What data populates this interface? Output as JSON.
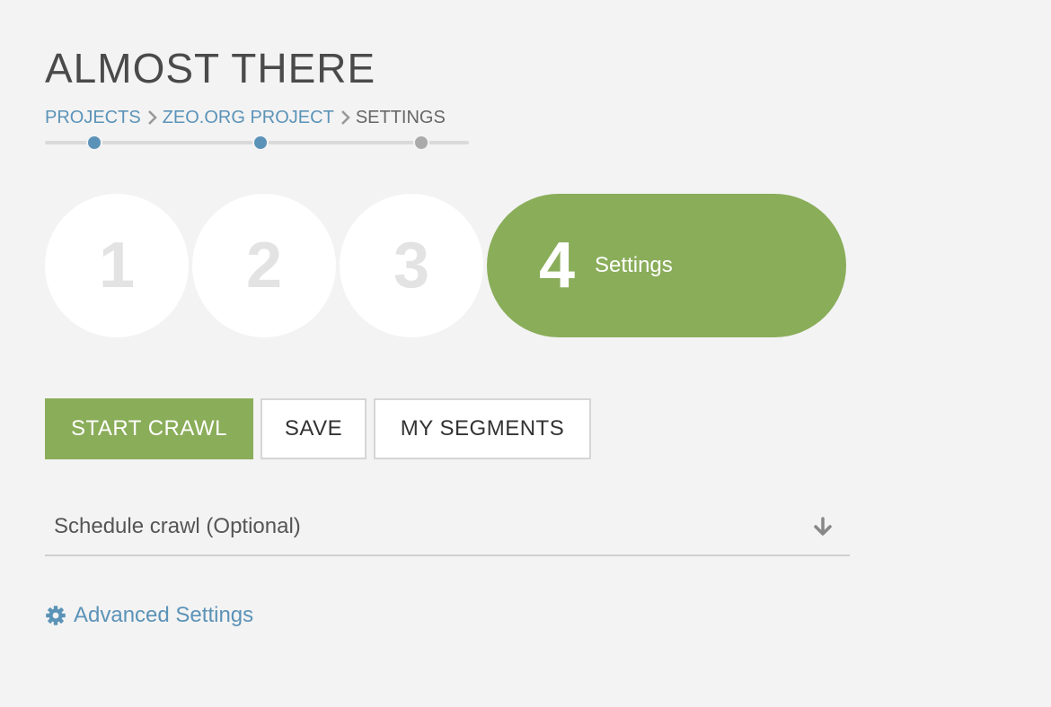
{
  "page": {
    "title": "ALMOST THERE"
  },
  "breadcrumb": {
    "items": [
      {
        "label": "PROJECTS",
        "link": true
      },
      {
        "label": "ZEO.ORG PROJECT",
        "link": true
      },
      {
        "label": "SETTINGS",
        "link": false
      }
    ],
    "separator_icon": "chevron-right-icon"
  },
  "progress": {
    "dots": [
      {
        "state": "complete",
        "color": "#5b93b8"
      },
      {
        "state": "complete",
        "color": "#5b93b8"
      },
      {
        "state": "current",
        "color": "#aaaaaa"
      }
    ]
  },
  "steps": {
    "items": [
      {
        "number": "1"
      },
      {
        "number": "2"
      },
      {
        "number": "3"
      }
    ],
    "active": {
      "number": "4",
      "label": "Settings"
    }
  },
  "actions": {
    "start_crawl": "START CRAWL",
    "save": "SAVE",
    "my_segments": "MY SEGMENTS"
  },
  "schedule": {
    "label": "Schedule crawl (Optional)",
    "icon": "arrow-down-icon"
  },
  "advanced": {
    "label": "Advanced Settings",
    "icon": "gear-icon"
  },
  "colors": {
    "accent_green": "#8aad5a",
    "link_blue": "#5b93b8",
    "inactive_gray": "#aaaaaa"
  }
}
